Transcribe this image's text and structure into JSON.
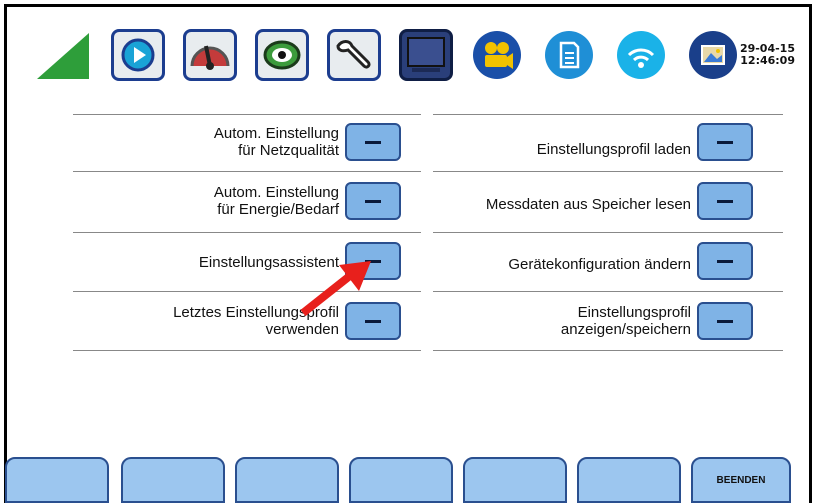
{
  "status": {
    "date": "29-04-15",
    "time": "12:46:09"
  },
  "toolbar_icons": [
    "signal-strength-icon",
    "play-icon",
    "gauge-icon",
    "eye-icon",
    "wrench-icon",
    "monitor-icon",
    "camera-icon",
    "document-icon",
    "wifi-icon",
    "picture-icon"
  ],
  "left_items": [
    {
      "line1": "Autom. Einstellung",
      "line2": "für Netzqualität"
    },
    {
      "line1": "Autom. Einstellung",
      "line2": "für Energie/Bedarf"
    },
    {
      "line1": "Einstellungsassistent",
      "line2": ""
    },
    {
      "line1": "Letztes Einstellungsprofil",
      "line2": "verwenden"
    }
  ],
  "right_items": [
    {
      "line1": "Einstellungsprofil laden",
      "line2": ""
    },
    {
      "line1": "Messdaten aus Speicher lesen",
      "line2": ""
    },
    {
      "line1": "Gerätekonfiguration ändern",
      "line2": ""
    },
    {
      "line1": "Einstellungsprofil",
      "line2": "anzeigen/speichern"
    }
  ],
  "softkeys": [
    "",
    "",
    "",
    "",
    "",
    "",
    "BEENDEN"
  ],
  "colors": {
    "button_fill": "#7fb3e6",
    "button_border": "#2a4f8f",
    "signal": "#2e9e3a",
    "arrow": "#e8201c"
  }
}
